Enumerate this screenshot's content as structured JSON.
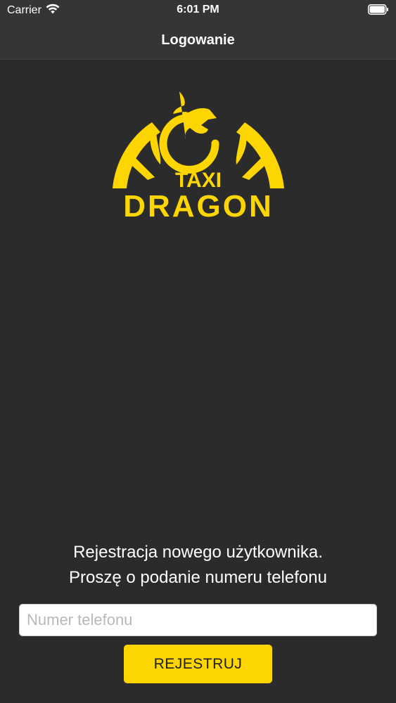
{
  "status_bar": {
    "carrier": "Carrier",
    "time": "6:01 PM",
    "icons": [
      "wifi-icon",
      "battery-icon"
    ]
  },
  "nav": {
    "title": "Logowanie"
  },
  "logo": {
    "line1": "TAXI",
    "line2": "DRAGON",
    "color": "#fdd500"
  },
  "registration": {
    "line1": "Rejestracja nowego użytkownika.",
    "line2": "Proszę o podanie numeru telefonu"
  },
  "form": {
    "phone_placeholder": "Numer telefonu",
    "phone_value": "",
    "register_label": "REJESTRUJ"
  },
  "colors": {
    "background": "#2b2b2b",
    "bar": "#353535",
    "accent": "#fdd500"
  }
}
